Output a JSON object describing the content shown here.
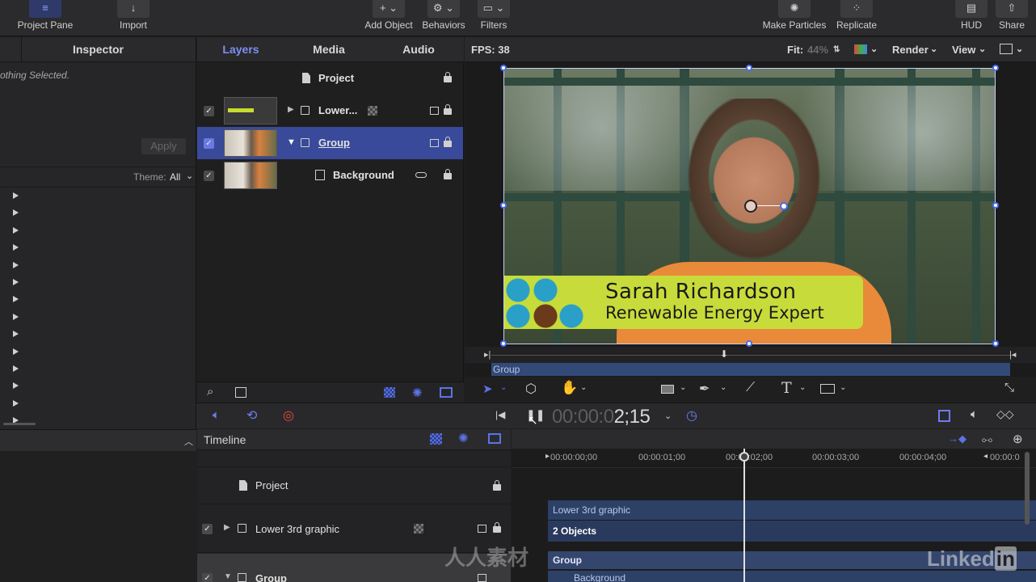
{
  "toolbar": {
    "project_pane": "Project Pane",
    "import": "Import",
    "add_object": "Add Object",
    "behaviors": "Behaviors",
    "filters": "Filters",
    "make_particles": "Make Particles",
    "replicate": "Replicate",
    "hud": "HUD",
    "share": "Share"
  },
  "inspector": {
    "tab": "Inspector",
    "nothing_selected": "othing Selected.",
    "apply": "Apply",
    "theme_label": "Theme:",
    "theme_value": "All"
  },
  "layers_panel": {
    "tabs": [
      "Layers",
      "Media",
      "Audio"
    ],
    "project": "Project",
    "rows": [
      {
        "name": "Lower..."
      },
      {
        "name": "Group"
      },
      {
        "name": "Background"
      }
    ]
  },
  "canvas": {
    "fps": "FPS: 38",
    "fit_label": "Fit:",
    "fit_value": "44%",
    "render": "Render",
    "view": "View",
    "lower_third_name": "Sarah Richardson",
    "lower_third_title": "Renewable Energy Expert",
    "mini_group": "Group"
  },
  "transport": {
    "timecode_dim": "00:00:0",
    "timecode": "2;15"
  },
  "timeline": {
    "header": "Timeline",
    "project": "Project",
    "rows": [
      {
        "name": "Lower 3rd graphic"
      },
      {
        "name": "Group"
      }
    ],
    "ruler": [
      "00:00:00;00",
      "00:00:01;00",
      "00:00:02;00",
      "00:00:03;00",
      "00:00:04;00",
      "00:00:0"
    ],
    "bars": {
      "lower3": "Lower 3rd graphic",
      "objects": "2 Objects",
      "group": "Group",
      "background": "Background"
    }
  },
  "watermark": {
    "brand": "LinkedIn",
    "brand_a": "Linked",
    "brand_b": "in",
    "cn": "人人素材"
  },
  "colors": {
    "selection": "#3a4a9a",
    "accent_blue": "#5b73e8",
    "accent_red": "#e8483a",
    "lower_third_green": "#c7dc3a",
    "shirt_orange": "#e98a3a"
  }
}
